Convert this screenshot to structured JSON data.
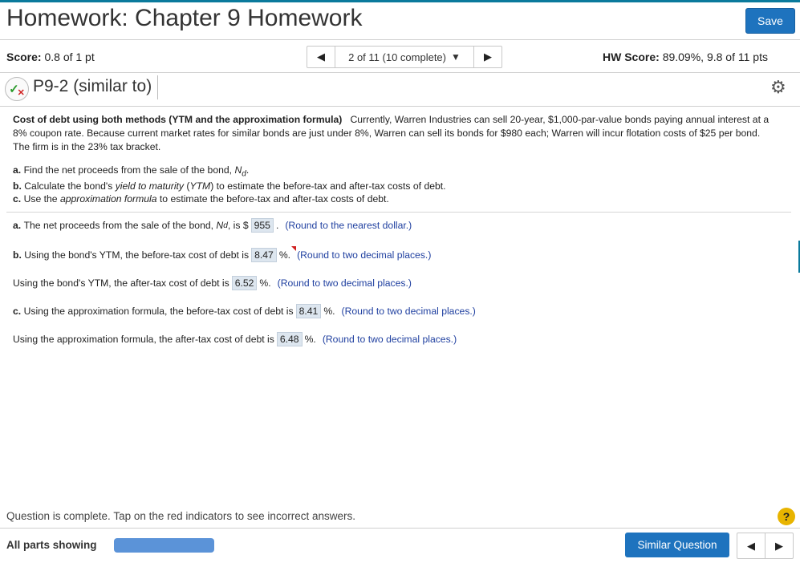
{
  "header": {
    "title": "Homework: Chapter 9 Homework",
    "save_label": "Save"
  },
  "scorebar": {
    "score_label": "Score:",
    "score_value": "0.8 of 1 pt",
    "nav_prev_icon": "left-triangle-icon",
    "nav_text": "2 of 11 (10 complete)",
    "nav_caret": "▼",
    "nav_next_icon": "right-triangle-icon",
    "hw_score_label": "HW Score:",
    "hw_score_value": "89.09%, 9.8 of 11 pts"
  },
  "question": {
    "status_icon": "partial-correct-icon",
    "title": "P9-2 (similar to)",
    "settings_icon": "gear-icon",
    "intro_bold": "Cost of debt using both methods (YTM and the approximation formula)",
    "intro_text": "Currently, Warren Industries can sell 20-year, $1,000-par-value bonds paying annual interest at a 8% coupon rate. Because current market rates for similar bonds are just under 8%, Warren can sell its bonds for $980 each; Warren will incur flotation costs of $25 per bond. The firm is in the 23% tax bracket.",
    "parts": [
      {
        "prefix": "a.",
        "text_before": "Find the net proceeds from the sale of the bond, ",
        "var": "N",
        "sub": "d",
        "text_after": "."
      },
      {
        "prefix": "b.",
        "text_before": "Calculate the bond's ",
        "italic1": "yield to maturity",
        "mid1": " (",
        "italic2": "YTM",
        "text_after": ") to estimate the before-tax and after-tax costs of debt."
      },
      {
        "prefix": "c.",
        "text_before": "Use the ",
        "italic1": "approximation formula",
        "text_after": " to estimate the before-tax and after-tax costs of debt."
      }
    ]
  },
  "answers": [
    {
      "prefix": "a.",
      "before": "The net proceeds from the sale of the bond, ",
      "var": "N",
      "sub": "d",
      "mid": ", is $",
      "value": "955",
      "after": ".",
      "hint": "(Round to the nearest dollar.)"
    },
    {
      "prefix": "b.",
      "before": "Using the bond's YTM, the before-tax cost of debt is",
      "value": "8.47",
      "after": "%.",
      "hint": "(Round to two decimal places.)",
      "flag": "incorrect"
    },
    {
      "prefix": "",
      "before": "Using the bond's YTM, the after-tax cost of debt is",
      "value": "6.52",
      "after": "%.",
      "hint": "(Round to two decimal places.)"
    },
    {
      "prefix": "c.",
      "before": "Using the approximation formula, the before-tax cost of debt is",
      "value": "8.41",
      "after": "%.",
      "hint": "(Round to two decimal places.)"
    },
    {
      "prefix": "",
      "before": "Using the approximation formula, the after-tax cost of debt is",
      "value": "6.48",
      "after": "%.",
      "hint": "(Round to two decimal places.)"
    }
  ],
  "footer": {
    "complete_msg": "Question is complete. Tap on the red indicators to see incorrect answers.",
    "help_icon": "?",
    "parts_label": "All parts showing",
    "similar_label": "Similar Question",
    "prev_icon": "left-triangle-icon",
    "next_icon": "right-triangle-icon"
  },
  "colors": {
    "accent": "#1e73be",
    "hint": "#2040a0",
    "answer_box": "#dde6ef",
    "progress": "#5b93d8",
    "help": "#e8b400",
    "flag": "#d02020"
  }
}
